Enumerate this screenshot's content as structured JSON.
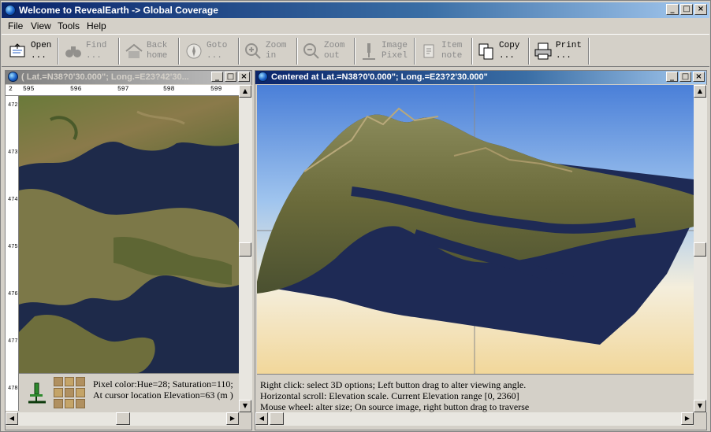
{
  "app": {
    "title": "Welcome to RevealEarth -> Global Coverage",
    "window_buttons": [
      "_",
      "□",
      "×"
    ]
  },
  "menu": [
    "File",
    "View",
    "Tools",
    "Help"
  ],
  "toolbar": [
    {
      "icon": "open-icon",
      "label": "Open\n...",
      "enabled": true
    },
    {
      "icon": "binoculars-icon",
      "label": "Find\n...",
      "enabled": false
    },
    {
      "icon": "home-icon",
      "label": "Back\nhome",
      "enabled": false
    },
    {
      "icon": "compass-icon",
      "label": "Goto\n...",
      "enabled": false
    },
    {
      "icon": "zoom-in-icon",
      "label": "Zoom\nin",
      "enabled": false
    },
    {
      "icon": "zoom-out-icon",
      "label": "Zoom\nout",
      "enabled": false
    },
    {
      "icon": "microscope-icon",
      "label": "Image\nPixel",
      "enabled": false
    },
    {
      "icon": "note-icon",
      "label": "Item\nnote",
      "enabled": false
    },
    {
      "icon": "copy-icon",
      "label": "Copy\n...",
      "enabled": true
    },
    {
      "icon": "printer-icon",
      "label": "Print\n...",
      "enabled": true
    }
  ],
  "left_panel": {
    "title": "( Lat.=N38?0'30.000\"; Long.=E23?42'30...",
    "ruler_corner": "2",
    "ruler_top": [
      "595",
      "596",
      "597",
      "598",
      "599"
    ],
    "ruler_left": [
      "472",
      "473",
      "474",
      "475",
      "476",
      "477",
      "478"
    ],
    "pixel_info_line1": "Pixel color:Hue=28;  Saturation=110;",
    "pixel_info_line2": "At cursor location Elevation=63 (m )"
  },
  "right_panel": {
    "title": "Centered at Lat.=N38?0'0.000\"; Long.=E23?2'30.000\"",
    "info_line1": "Right click: select 3D options; Left button drag to alter viewing angle.",
    "info_line2": "Horizontal scroll: Elevation scale. Current Elevation range [0, 2360]",
    "info_line3": "Mouse wheel: alter size; On source image, right button drag to traverse"
  }
}
